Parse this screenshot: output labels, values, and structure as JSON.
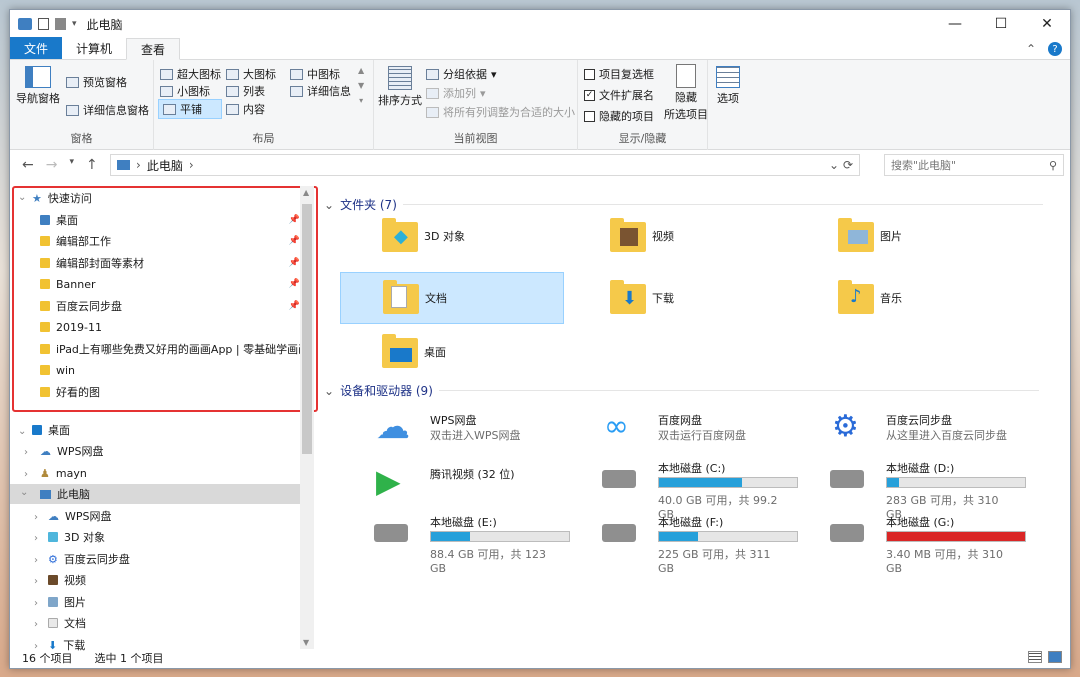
{
  "window": {
    "title": "此电脑"
  },
  "tabs": [
    "文件",
    "计算机",
    "查看"
  ],
  "ribbon": {
    "panes": {
      "nav_pane": "导航窗格",
      "preview_pane": "预览窗格",
      "details_pane": "详细信息窗格",
      "label": "窗格"
    },
    "layout": {
      "extra_large": "超大图标",
      "large": "大图标",
      "medium": "中图标",
      "small": "小图标",
      "list": "列表",
      "details": "详细信息",
      "tiles": "平铺",
      "content": "内容",
      "label": "布局"
    },
    "current_view": {
      "sort": "排序方式",
      "group": "分组依据",
      "add_column": "添加列",
      "fit_columns": "将所有列调整为合适的大小",
      "label": "当前视图"
    },
    "show_hide": {
      "item_checkboxes": "项目复选框",
      "file_ext": "文件扩展名",
      "hidden_items": "隐藏的项目",
      "hide_selected_1": "隐藏",
      "hide_selected_2": "所选项目",
      "label": "显示/隐藏"
    },
    "options": "选项"
  },
  "address": {
    "path": "此电脑",
    "search_placeholder": "搜索\"此电脑\""
  },
  "nav": {
    "quick_access": "快速访问",
    "pinned": [
      "桌面",
      "编辑部工作",
      "编辑部封面等素材",
      "Banner",
      "百度云同步盘"
    ],
    "recent": [
      "2019-11",
      "iPad上有哪些免费又好用的画画App | 零基础学画画",
      "win",
      "好看的图"
    ],
    "tree": [
      "桌面",
      "WPS网盘",
      "mayn",
      "此电脑",
      "WPS网盘",
      "3D 对象",
      "百度云同步盘",
      "视频",
      "图片",
      "文档",
      "下载"
    ]
  },
  "content": {
    "folders_header": "文件夹 (7)",
    "folders": [
      "3D 对象",
      "视频",
      "图片",
      "文档",
      "下载",
      "音乐",
      "桌面"
    ],
    "devices_header": "设备和驱动器 (9)",
    "apps": [
      {
        "name": "WPS网盘",
        "desc": "双击进入WPS网盘"
      },
      {
        "name": "百度网盘",
        "desc": "双击运行百度网盘"
      },
      {
        "name": "百度云同步盘",
        "desc": "从这里进入百度云同步盘"
      },
      {
        "name": "腾讯视频 (32 位)",
        "desc": ""
      }
    ],
    "drives": [
      {
        "name": "本地磁盘 (C:)",
        "free": "40.0 GB 可用，共 99.2 GB",
        "used_fraction": 0.6,
        "color": "#26a0da"
      },
      {
        "name": "本地磁盘 (D:)",
        "free": "283 GB 可用，共 310 GB",
        "used_fraction": 0.09,
        "color": "#26a0da"
      },
      {
        "name": "本地磁盘 (E:)",
        "free": "88.4 GB 可用，共 123 GB",
        "used_fraction": 0.28,
        "color": "#26a0da"
      },
      {
        "name": "本地磁盘 (F:)",
        "free": "225 GB 可用，共 311 GB",
        "used_fraction": 0.28,
        "color": "#26a0da"
      },
      {
        "name": "本地磁盘 (G:)",
        "free": "3.40 MB 可用，共 310 GB",
        "used_fraction": 1.0,
        "color": "#da2626"
      }
    ]
  },
  "status": {
    "count": "16 个项目",
    "selected": "选中 1 个项目"
  }
}
